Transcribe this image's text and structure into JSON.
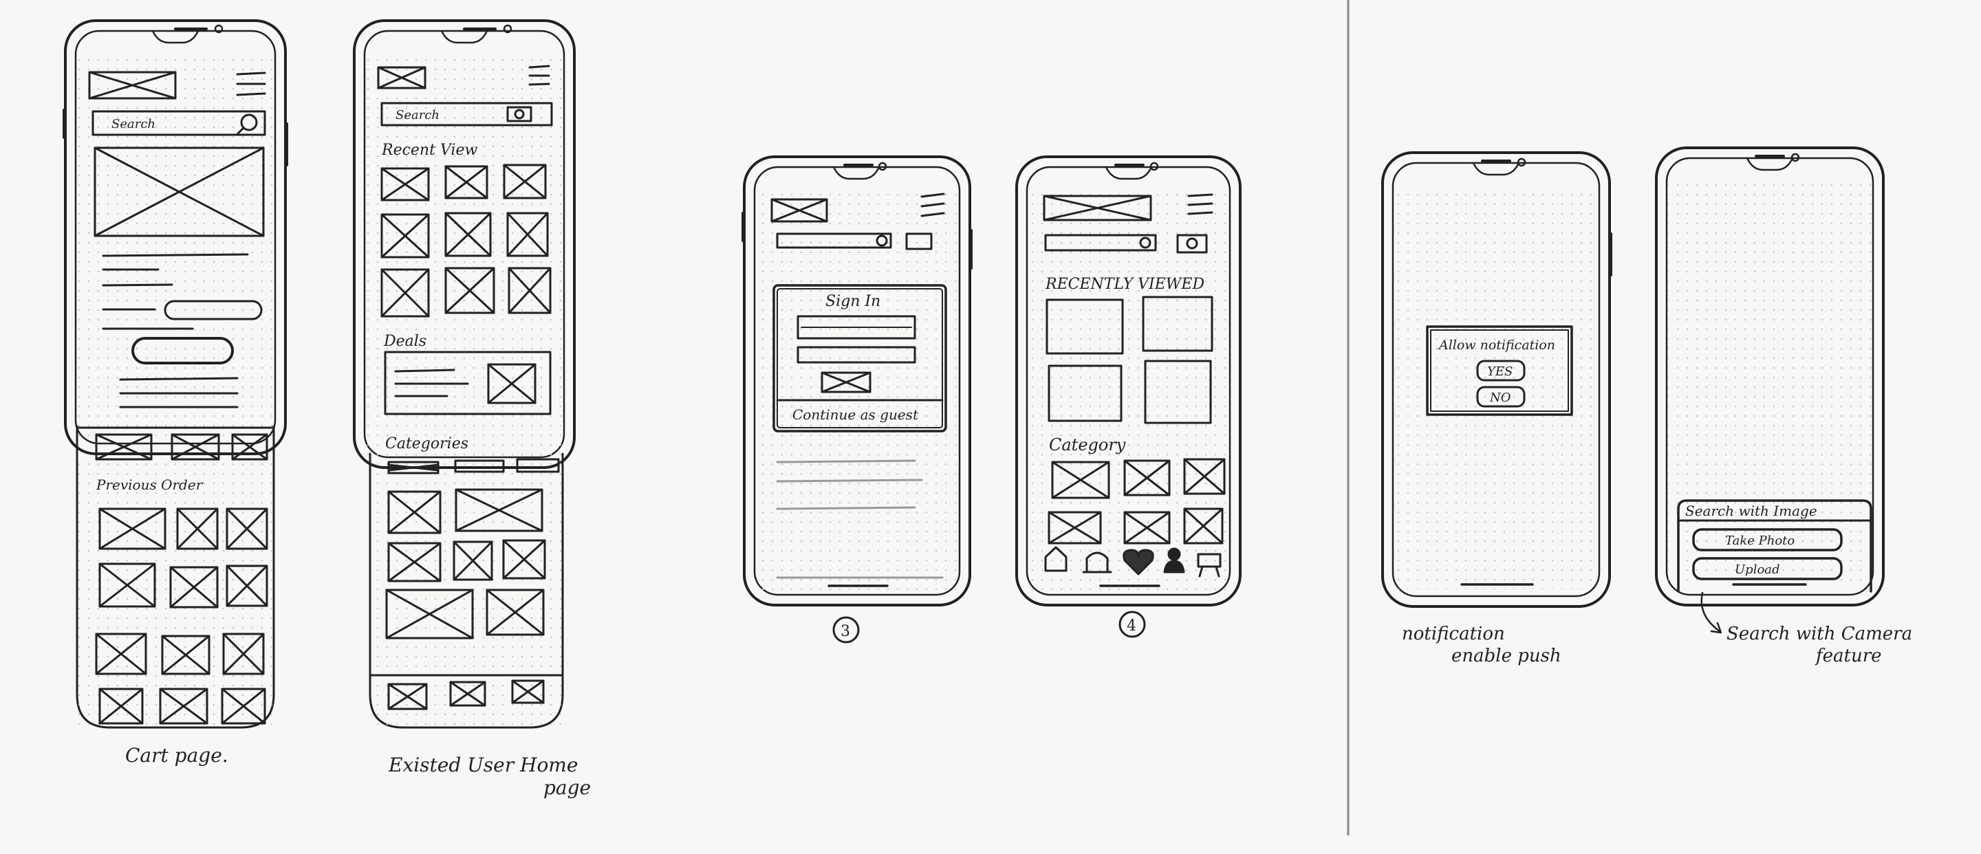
{
  "phone1": {
    "search": "Search",
    "section": "Previous Order"
  },
  "phone2": {
    "search": "Search",
    "recent": "Recent View",
    "deals": "Deals",
    "categories": "Categories"
  },
  "phone3": {
    "signin": "Sign In",
    "guest": "Continue as guest"
  },
  "phone4": {
    "recent": "RECENTLY VIEWED",
    "category": "Category"
  },
  "phone5": {
    "title": "Allow notification",
    "yes": "YES",
    "no": "NO"
  },
  "phone6": {
    "title": "Search with Image",
    "take": "Take Photo",
    "upload": "Upload"
  },
  "captions": {
    "cart": "Cart page.",
    "home_line1": "Existed User Home",
    "home_line2": "page",
    "num3": "3",
    "num4": "4",
    "notif_line1": "notification",
    "notif_line2": "enable push",
    "camera_line1": "Search with Camera",
    "camera_line2": "feature"
  },
  "colors": {
    "ink": "#222222",
    "paper": "#f7f7f5",
    "dots": "#c9c9c9"
  }
}
